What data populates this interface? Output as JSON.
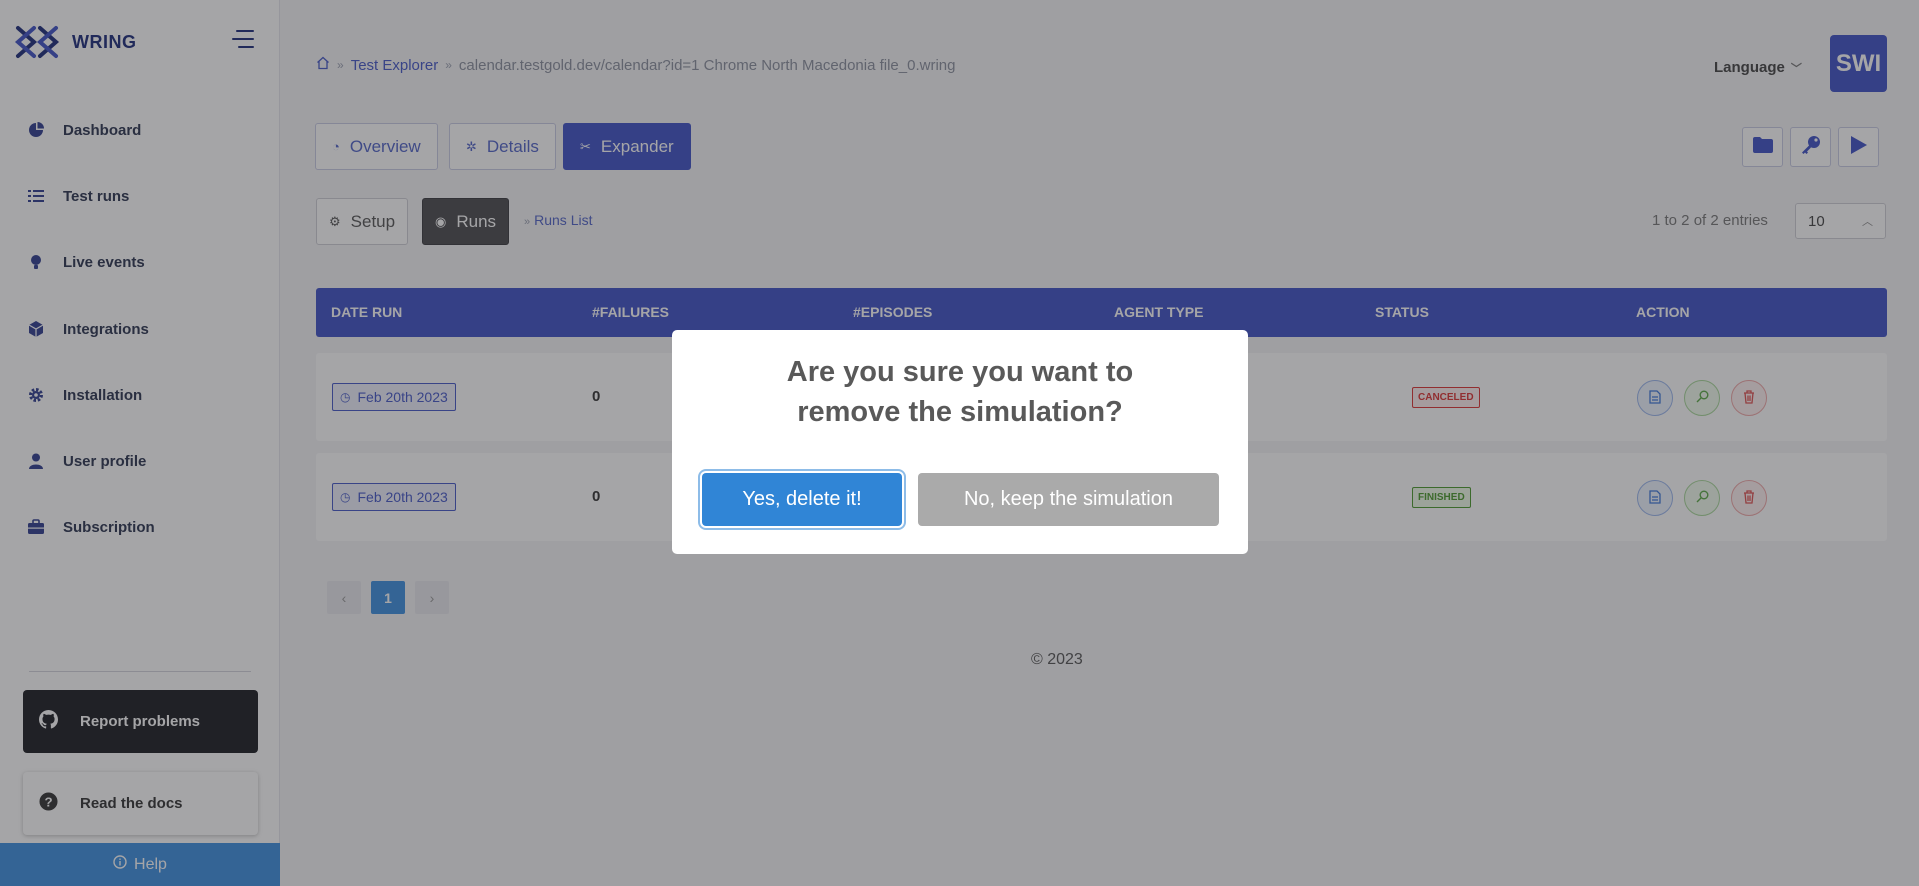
{
  "brand": {
    "name": "WRING",
    "logo_icon": "wring-logo-icon"
  },
  "sidebar": {
    "items": [
      {
        "label": "Dashboard",
        "icon": "pie-chart-icon"
      },
      {
        "label": "Test runs",
        "icon": "list-icon"
      },
      {
        "label": "Live events",
        "icon": "lightbulb-icon"
      },
      {
        "label": "Integrations",
        "icon": "cube-icon"
      },
      {
        "label": "Installation",
        "icon": "gear-icon"
      },
      {
        "label": "User profile",
        "icon": "user-icon"
      },
      {
        "label": "Subscription",
        "icon": "briefcase-icon"
      }
    ],
    "report_label": "Report problems",
    "docs_label": "Read the docs",
    "help_label": "Help"
  },
  "header": {
    "breadcrumb": {
      "explorer": "Test Explorer",
      "current": "calendar.testgold.dev/calendar?id=1 Chrome North Macedonia file_0.wring"
    },
    "language_label": "Language",
    "avatar_text": "SWI"
  },
  "tabs": {
    "overview": "Overview",
    "details": "Details",
    "expander": "Expander"
  },
  "subtabs": {
    "setup": "Setup",
    "runs": "Runs",
    "runs_list": "Runs List"
  },
  "entries_text": "1 to 2 of 2 entries",
  "page_size": "10",
  "table": {
    "headers": [
      "DATE RUN",
      "#FAILURES",
      "#EPISODES",
      "AGENT TYPE",
      "STATUS",
      "ACTION"
    ],
    "rows": [
      {
        "date": "Feb 20th 2023",
        "failures": "0",
        "status": "CANCELED"
      },
      {
        "date": "Feb 20th 2023",
        "failures": "0",
        "status": "FINISHED"
      }
    ]
  },
  "pagination": {
    "current": "1"
  },
  "copyright": "© 2023",
  "modal": {
    "title": "Are you sure you want to remove the simulation?",
    "confirm_label": "Yes, delete it!",
    "cancel_label": "No, keep the simulation"
  },
  "colors": {
    "primary": "#3f51c6",
    "confirm": "#3085d6",
    "cancel": "#aaaaaa",
    "canceled": "#dd3333",
    "finished": "#4a9a2c"
  }
}
